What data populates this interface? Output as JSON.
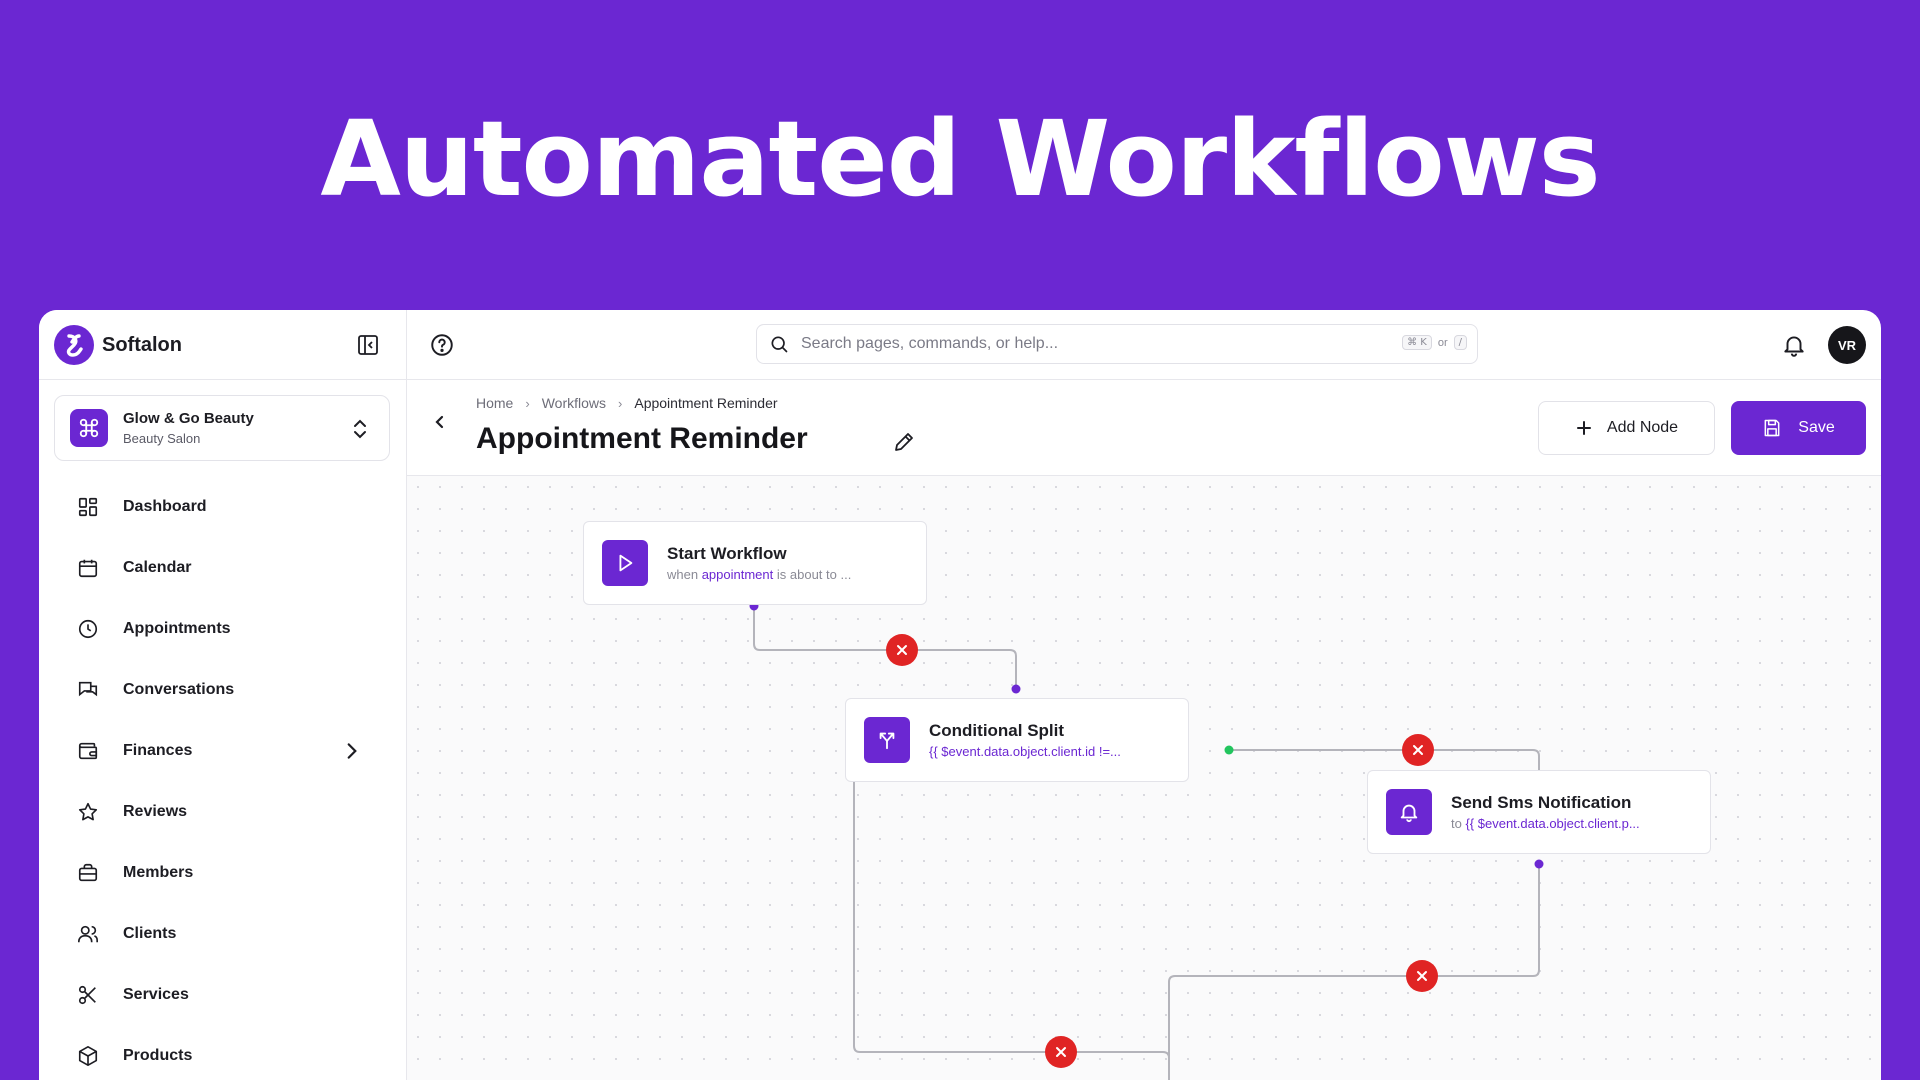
{
  "hero": {
    "title": "Automated Workflows"
  },
  "brand": {
    "name": "Softalon",
    "logo_icon": "softalon-logo"
  },
  "org": {
    "name": "Glow & Go Beauty",
    "type": "Beauty Salon",
    "icon": "command-icon"
  },
  "sidebar": {
    "items": [
      {
        "label": "Dashboard",
        "icon": "dashboard-icon"
      },
      {
        "label": "Calendar",
        "icon": "calendar-icon"
      },
      {
        "label": "Appointments",
        "icon": "clock-icon"
      },
      {
        "label": "Conversations",
        "icon": "chat-icon"
      },
      {
        "label": "Finances",
        "icon": "wallet-icon",
        "has_children": true
      },
      {
        "label": "Reviews",
        "icon": "star-icon"
      },
      {
        "label": "Members",
        "icon": "briefcase-icon"
      },
      {
        "label": "Clients",
        "icon": "users-icon"
      },
      {
        "label": "Services",
        "icon": "scissors-icon"
      },
      {
        "label": "Products",
        "icon": "box-icon"
      }
    ]
  },
  "topbar": {
    "search_placeholder": "Search pages, commands, or help...",
    "shortcut_key1": "⌘ K",
    "shortcut_or": "or",
    "shortcut_key2": "/",
    "avatar_initials": "VR"
  },
  "breadcrumb": {
    "home": "Home",
    "workflows": "Workflows",
    "current": "Appointment Reminder"
  },
  "page": {
    "title": "Appointment Reminder"
  },
  "actions": {
    "add_node": "Add Node",
    "save": "Save"
  },
  "nodes": {
    "start": {
      "title": "Start Workflow",
      "sub_prefix": "when ",
      "sub_highlight": "appointment",
      "sub_suffix": " is about to ..."
    },
    "split": {
      "title": "Conditional Split",
      "sub": "{{ $event.data.object.client.id !=..."
    },
    "sms": {
      "title": "Send Sms Notification",
      "sub_prefix": "to ",
      "sub": "{{ $event.data.object.client.p..."
    }
  },
  "colors": {
    "accent": "#6b27d2",
    "danger": "#e02424",
    "success": "#22c55e",
    "edge": "#b4b4bb"
  }
}
